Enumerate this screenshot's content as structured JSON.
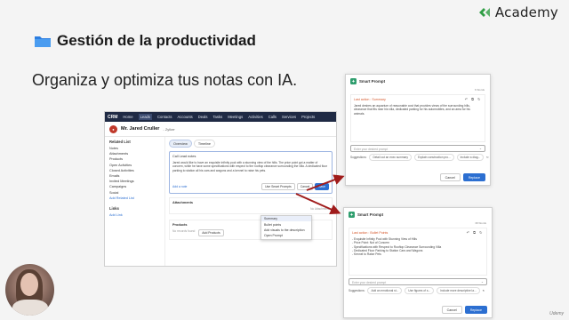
{
  "brand": {
    "name": "Academy",
    "color": "#2f9e44"
  },
  "slide": {
    "title": "Gestión de la productividad",
    "subtitle": "Organiza y optimiza tus notas con IA."
  },
  "crm": {
    "app_name": "CRM",
    "nav": [
      "Home",
      "Leads",
      "Contacts",
      "Accounts",
      "Deals",
      "Tasks",
      "Meetings",
      "Activities",
      "Calls",
      "Services",
      "Projects"
    ],
    "active_nav": "Leads",
    "record_name": "Mr. Jared Cruller",
    "record_company": "- Zylker",
    "sidebar_heading": "Related List",
    "sidebar_items": [
      "Notes",
      "Attachments",
      "Products",
      "Open Activities",
      "Closed Activities",
      "Emails",
      "Invited Meetings",
      "Campaigns",
      "Social"
    ],
    "sidebar_add_link": "Add Related List",
    "links_heading": "Links",
    "links_add": "Add Link",
    "tabs": [
      "Overview",
      "Timeline"
    ],
    "note_title": "Call Lead notes",
    "note_text": "Jared would like to have an exquisite infinity pool with a stunning view of the hills. The price point got a matter of concern, while he have some specifications with respect to the rooftop clearance surrounding the villa. A dedicated floor parking to station all his cars and wagons and a kennel to raise his pets.",
    "note_owner": "Add a note",
    "smart_prompt_label": "Use Smart Prompts",
    "cancel_label": "Cancel",
    "save_label": "Save",
    "menu_items": [
      "Summary",
      "Bullet points",
      "Add visuals to the description",
      "Open Prompt"
    ],
    "attachments_label": "Attachments",
    "attachments_empty": "No Attachment",
    "products_label": "Products",
    "products_empty": "No records found",
    "add_products": "Add Products"
  },
  "dialog1": {
    "title": "Smart Prompt",
    "meta": "6 Words",
    "label": "Last action : Summary",
    "text": "Jared desires an aquarium of reasonable cost that provides views of the surrounding hills, clearance that fits near his villa, dedicated parking for his automobiles, and an area for his animals.",
    "input_placeholder": "Enter your desired prompt",
    "suggestions_label": "Suggestions:",
    "suggestions": [
      "Detail out an exec summary",
      "Explain construction pro...",
      "Include a diag..."
    ],
    "cancel": "Cancel",
    "replace": "Replace"
  },
  "dialog2": {
    "title": "Smart Prompt",
    "meta": "38 Words",
    "label": "Last action : Bullet Points",
    "bullets": [
      "- Exquisite Infinity Pool with Stunning View of Hills",
      "- Price Point: Not of Concern",
      "- Specifications with Respect to Rooftop Clearance Surrounding Villa",
      "- Dedicated Floor Parking to Station Cars and Wagons",
      "- Kennel to Raise Pets"
    ],
    "input_placeholder": "Enter your desired prompt",
    "suggestions_label": "Suggestions:",
    "suggestions": [
      "Add an emotional st...",
      "Use figures of s...",
      "Include more descriptive la..."
    ],
    "cancel": "Cancel",
    "replace": "Replace"
  },
  "watermark": "Udemy"
}
